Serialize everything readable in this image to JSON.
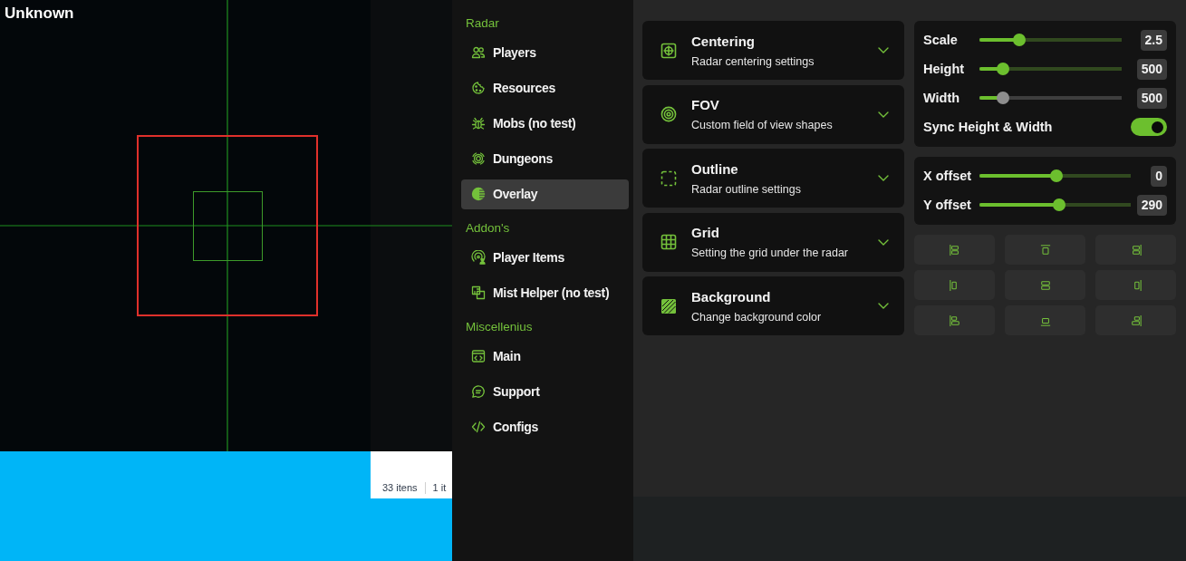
{
  "overlay_label": "Unknown",
  "explorer_status": [
    "33 itens",
    "1 it"
  ],
  "sidebar": {
    "sections": [
      {
        "heading": "Radar",
        "items": [
          {
            "label": "Players",
            "selected": false
          },
          {
            "label": "Resources",
            "selected": false
          },
          {
            "label": "Mobs (no test)",
            "selected": false
          },
          {
            "label": "Dungeons",
            "selected": false
          },
          {
            "label": "Overlay",
            "selected": true
          }
        ]
      },
      {
        "heading": "Addon's",
        "items": [
          {
            "label": "Player Items",
            "selected": false
          },
          {
            "label": "Mist Helper (no test)",
            "selected": false
          }
        ]
      },
      {
        "heading": "Miscellenius",
        "items": [
          {
            "label": "Main",
            "selected": false
          },
          {
            "label": "Support",
            "selected": false
          },
          {
            "label": "Configs",
            "selected": false
          }
        ]
      }
    ]
  },
  "setting_cards": [
    {
      "title": "Centering",
      "subtitle": "Radar centering settings",
      "expanded": false
    },
    {
      "title": "FOV",
      "subtitle": "Custom field of view shapes",
      "expanded": false
    },
    {
      "title": "Outline",
      "subtitle": "Radar outline settings",
      "expanded": false
    },
    {
      "title": "Grid",
      "subtitle": "Setting the grid under the radar",
      "expanded": false
    },
    {
      "title": "Background",
      "subtitle": "Change background color",
      "expanded": false
    }
  ],
  "size_panel": {
    "sliders": [
      {
        "label": "Scale",
        "level": 0.26,
        "reading": "2.5",
        "disabled": false
      },
      {
        "label": "Height",
        "level": 0.13,
        "reading": "500",
        "disabled": false
      },
      {
        "label": "Width",
        "level": 0.13,
        "reading": "500",
        "disabled": true
      }
    ],
    "toggle": {
      "label": "Sync Height & Width",
      "on": true
    }
  },
  "offset_panel": {
    "sliders": [
      {
        "label": "X offset",
        "level": 0.51,
        "reading": "0",
        "disabled": false
      },
      {
        "label": "Y offset",
        "level": 0.53,
        "reading": "290",
        "disabled": false
      }
    ]
  }
}
